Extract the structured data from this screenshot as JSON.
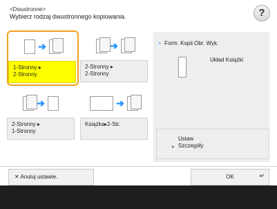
{
  "header": {
    "line1": "<Dwustronne>",
    "line2": "Wybierz rodzaj dwustronnego kopiowania."
  },
  "help_label": "?",
  "options": [
    {
      "label_line1": "1-Stronny ▸",
      "label_line2": "2-Stronny",
      "selected": true
    },
    {
      "label_line1": "2-Stronny ▸",
      "label_line2": "2-Stronny",
      "selected": false
    },
    {
      "label_line1": "2-Stronny ▸",
      "label_line2": "1-Stronny",
      "selected": false
    },
    {
      "label_line1": "Książka▸2-Str.",
      "label_line2": "",
      "selected": false
    }
  ],
  "right_panel": {
    "title": "Form. Kopii Obr. Wyk.",
    "layout_label": "Układ Książki",
    "settings_line1": "Ustaw",
    "settings_line2": "Szczegóły"
  },
  "bottom": {
    "cancel_label": "✕ Anuluj ustawie.",
    "ok_label": "OK"
  },
  "colors": {
    "selected_fill": "#ffff00",
    "selected_border": "#f0a020",
    "arrow": "#1e90ff",
    "footer": "#1e1e1e"
  }
}
